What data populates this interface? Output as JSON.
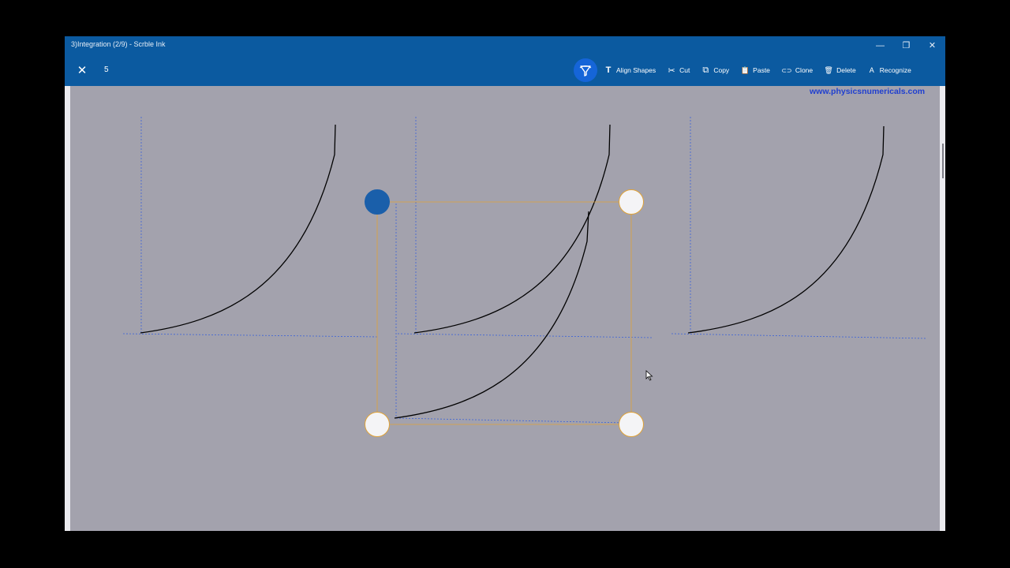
{
  "window": {
    "title": "3)Integration (2/9) - Scrble Ink",
    "controls": {
      "minimize": "—",
      "restore": "❐",
      "close": "✕"
    }
  },
  "toolbar": {
    "close_glyph": "✕",
    "page_number": "5",
    "lasso_icon": "lasso-select-icon",
    "tools": [
      {
        "name": "align-shapes",
        "label": "Align Shapes",
        "icon": "T"
      },
      {
        "name": "cut",
        "label": "Cut",
        "icon": "✂"
      },
      {
        "name": "copy",
        "label": "Copy",
        "icon": "⧉"
      },
      {
        "name": "paste",
        "label": "Paste",
        "icon": "📋"
      },
      {
        "name": "clone",
        "label": "Clone",
        "icon": "⊂⊃"
      },
      {
        "name": "delete",
        "label": "Delete",
        "icon": "🗑"
      },
      {
        "name": "recognize",
        "label": "Recognize",
        "icon": "A"
      }
    ]
  },
  "canvas": {
    "watermark": "www.physicsnumericals.com"
  },
  "colors": {
    "toolbar_bg": "#0b5aa0",
    "canvas_bg": "#a3a2ad",
    "accent": "#1565d8",
    "watermark": "#1f3fd0",
    "selection": "#e0a338"
  }
}
